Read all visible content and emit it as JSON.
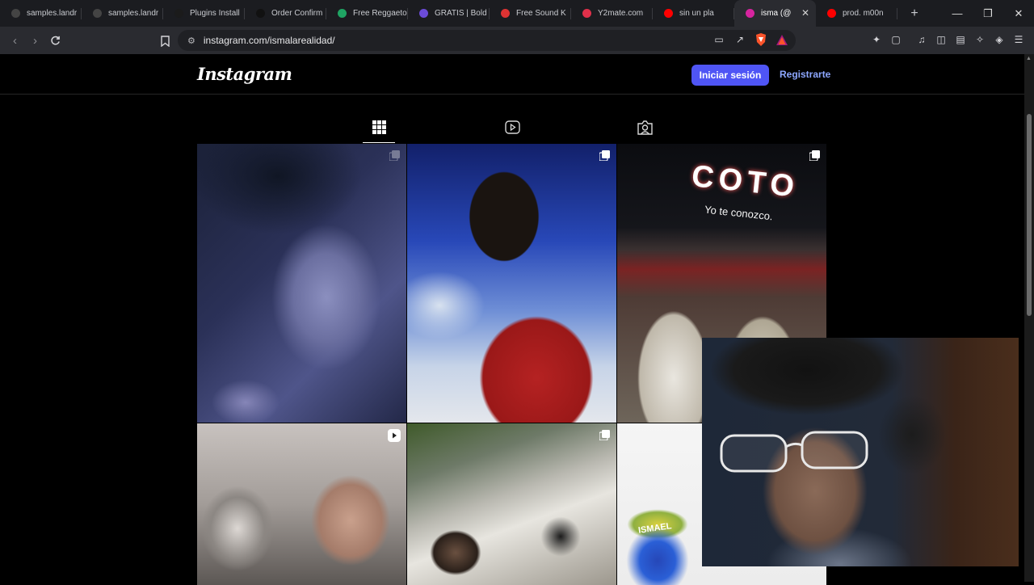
{
  "browser": {
    "tabs": [
      {
        "title": "samples.landr",
        "favicon": "landr-icon",
        "color": "#444"
      },
      {
        "title": "samples.landr",
        "favicon": "landr-icon",
        "color": "#444"
      },
      {
        "title": "Plugins Install",
        "favicon": "plugin-icon",
        "color": "#1b1b1b"
      },
      {
        "title": "Order Confirm",
        "favicon": "v-icon",
        "color": "#111"
      },
      {
        "title": "Free Reggaeton",
        "favicon": "drive-icon",
        "color": "#1fa463"
      },
      {
        "title": "GRATIS | Bold",
        "favicon": "3-icon",
        "color": "#6b4bd8"
      },
      {
        "title": "Free Sound K",
        "favicon": "gmail-icon",
        "color": "#d33"
      },
      {
        "title": "Y2mate.com",
        "favicon": "download-icon",
        "color": "#e0304a"
      },
      {
        "title": "sin un pla",
        "favicon": "youtube-icon",
        "color": "#ff0000"
      },
      {
        "title": "isma (@",
        "favicon": "instagram-icon",
        "color": "#d6249f",
        "active": true
      },
      {
        "title": "prod. m00n",
        "favicon": "youtube-icon",
        "color": "#ff0000"
      }
    ],
    "new_tab": "+",
    "url": "instagram.com/ismalarealidad/"
  },
  "instagram": {
    "logo": "Instagram",
    "login_label": "Iniciar sesión",
    "signup_label": "Registrarte",
    "profile_tabs": [
      "posts-grid-icon",
      "reels-icon",
      "tagged-icon"
    ],
    "posts": [
      {
        "type": "image",
        "badge": "carousel-icon"
      },
      {
        "type": "image",
        "badge": "carousel-icon"
      },
      {
        "type": "image",
        "badge": "carousel-icon",
        "sign_text": "COTO",
        "sign_sub": "Yo te conozco."
      },
      {
        "type": "reel",
        "badge": "reel-icon"
      },
      {
        "type": "image",
        "badge": "carousel-icon"
      },
      {
        "type": "image",
        "badge": "",
        "caption_text": "ISMAEL"
      }
    ]
  },
  "colors": {
    "accent": "#4f55f5",
    "link": "#8da7ff"
  }
}
